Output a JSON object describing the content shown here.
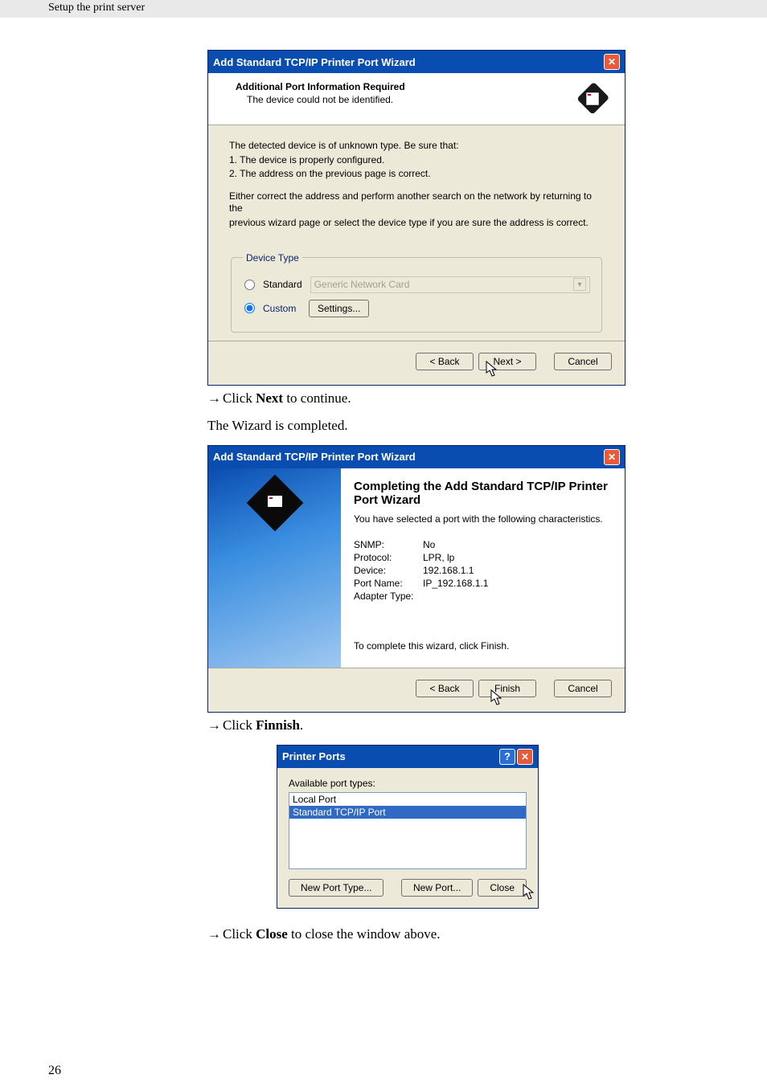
{
  "page": {
    "header": "Setup the print server",
    "number": "26"
  },
  "dialog1": {
    "title": "Add Standard TCP/IP Printer Port Wizard",
    "header_title": "Additional Port Information Required",
    "header_sub": "The device could not be identified.",
    "body_line1": "The detected device is of unknown type.  Be sure that:",
    "body_line2": "1.  The device is properly configured.",
    "body_line3": "2.  The address on the previous page is correct.",
    "body_para2a": "Either correct the address and perform another search on the network by returning to the",
    "body_para2b": "previous wizard page or select the device type if you are sure the address is correct.",
    "legend": "Device Type",
    "standard_label": "Standard",
    "standard_value": "Generic Network Card",
    "custom_label": "Custom",
    "settings_btn": "Settings...",
    "back": "< Back",
    "next": "Next >",
    "cancel": "Cancel"
  },
  "instr1_prefix": "Click ",
  "instr1_bold": "Next",
  "instr1_suffix": " to continue.",
  "instr_mid": "The Wizard is completed.",
  "dialog2": {
    "title": "Add Standard TCP/IP Printer Port Wizard",
    "h2": "Completing the Add Standard TCP/IP Printer Port Wizard",
    "desc": "You have selected a port with the following characteristics.",
    "kv": {
      "snmp_k": "SNMP:",
      "snmp_v": "No",
      "proto_k": "Protocol:",
      "proto_v": "LPR, lp",
      "dev_k": "Device:",
      "dev_v": "192.168.1.1",
      "port_k": "Port Name:",
      "port_v": "IP_192.168.1.1",
      "adap_k": "Adapter Type:",
      "adap_v": ""
    },
    "complete_msg": "To complete this wizard, click Finish.",
    "back": "< Back",
    "finish": "Finish",
    "cancel": "Cancel"
  },
  "instr2_prefix": "Click ",
  "instr2_bold": "Finnish",
  "instr2_suffix": ".",
  "dialog3": {
    "title": "Printer Ports",
    "label": "Available port types:",
    "item1": "Local Port",
    "item2": "Standard TCP/IP Port",
    "new_port_type": "New Port Type...",
    "new_port": "New Port...",
    "close": "Close"
  },
  "instr3_prefix": "Click ",
  "instr3_bold": "Close",
  "instr3_suffix": " to close the window above."
}
